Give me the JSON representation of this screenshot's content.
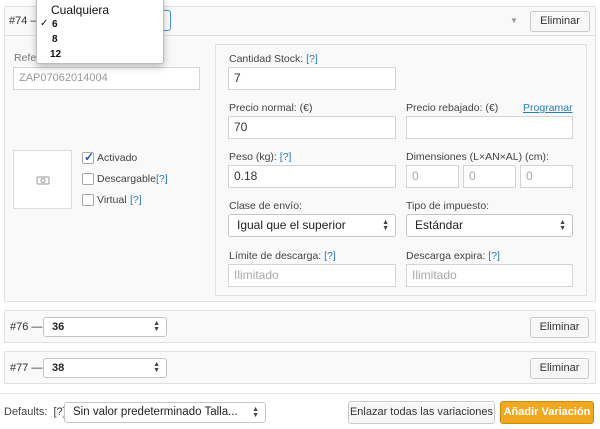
{
  "variation74": {
    "id_label": "#74 —",
    "remove_label": "Eliminar",
    "dropdown": {
      "options": [
        {
          "label": "Cualquiera",
          "checked": false
        },
        {
          "label": "6",
          "checked": true
        },
        {
          "label": "8",
          "checked": false
        },
        {
          "label": "12",
          "checked": false
        }
      ],
      "check_mark": "✓"
    },
    "sku": {
      "label": "Refe",
      "value": "ZAP07062014004"
    },
    "image": {
      "icon": "image-placeholder-icon"
    },
    "checkboxes": [
      {
        "label": "Activado",
        "help": "",
        "checked": true
      },
      {
        "label": "Descargable",
        "help": "[?]",
        "checked": false
      },
      {
        "label": "Virtual",
        "help": "[?]",
        "checked": false
      }
    ],
    "stock": {
      "label": "Cantidad Stock:",
      "help": "[?]",
      "value": "7"
    },
    "regular_price": {
      "label": "Precio normal: (€)",
      "value": "70"
    },
    "sale_price": {
      "label": "Precio rebajado: (€)",
      "link": "Programar",
      "value": ""
    },
    "weight": {
      "label": "Peso (kg):",
      "help": "[?]",
      "value": "0.18"
    },
    "dimensions": {
      "label": "Dimensiones (L×AN×AL) (cm):",
      "placeholders": [
        "0",
        "0",
        "0"
      ]
    },
    "shipping_class": {
      "label": "Clase de envío:",
      "value": "Igual que el superior"
    },
    "tax_class": {
      "label": "Tipo de impuesto:",
      "value": "Estándar"
    },
    "download_limit": {
      "label": "Límite de descarga:",
      "help": "[?]",
      "placeholder": "Ilimitado"
    },
    "download_expiry": {
      "label": "Descarga expira:",
      "help": "[?]",
      "placeholder": "Ilimitado"
    }
  },
  "variation76": {
    "id_label": "#76 —",
    "value": "36",
    "remove_label": "Eliminar"
  },
  "variation77": {
    "id_label": "#77 —",
    "value": "38",
    "remove_label": "Eliminar"
  },
  "footer": {
    "defaults_label": "Defaults:",
    "defaults_help": "[?]",
    "defaults_value": "Sin valor predeterminado Talla...",
    "link_all_label": "Enlazar todas las variaciones",
    "add_variation_label": "Añadir Variación"
  },
  "colors": {
    "primary_button": "#f0a820",
    "help_link": "#2a7bb5"
  }
}
